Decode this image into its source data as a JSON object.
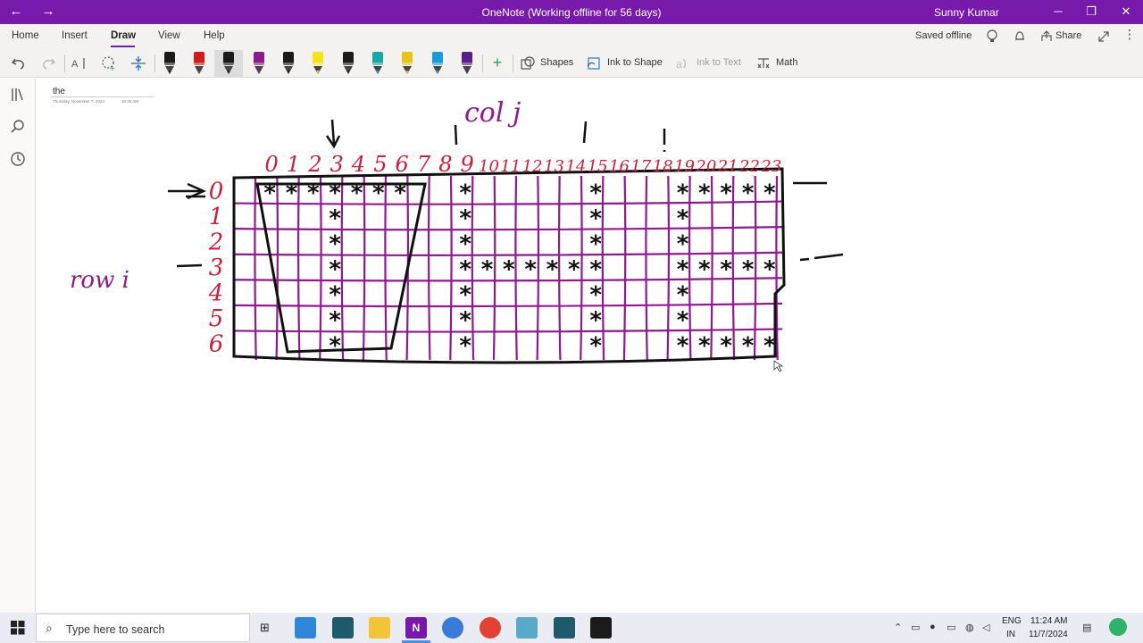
{
  "titlebar": {
    "title": "OneNote (Working offline for 56 days)",
    "user": "Sunny Kumar",
    "back": "←",
    "forward": "→",
    "minimize": "─",
    "maximize": "❐",
    "close": "✕"
  },
  "tabs": [
    "Home",
    "Insert",
    "Draw",
    "View",
    "Help"
  ],
  "active_tab": "Draw",
  "status": {
    "saved": "Saved offline",
    "share": "Share"
  },
  "toolbar": {
    "shapes": "Shapes",
    "ink_to_shape": "Ink to Shape",
    "ink_to_text": "Ink to Text",
    "math": "Math"
  },
  "pens": [
    {
      "color": "#1a1a1a"
    },
    {
      "color": "#d11c1c"
    },
    {
      "color": "#1a1a1a"
    },
    {
      "color": "#8b1d8b"
    },
    {
      "color": "#1a1a1a"
    },
    {
      "color": "#f4e21c"
    },
    {
      "color": "#1a1a1a"
    },
    {
      "color": "#1aa7a7"
    },
    {
      "color": "#e6c21c"
    },
    {
      "color": "#1a9ad6"
    },
    {
      "color": "#5a1d8b"
    }
  ],
  "page": {
    "title": "the",
    "date": "Thursday, November 7, 2024",
    "time": "10:25 AM"
  },
  "ink_labels": {
    "col": "col j",
    "row": "row i",
    "col_numbers": [
      "0",
      "1",
      "2",
      "3",
      "4",
      "5",
      "6",
      "7",
      "8",
      "9",
      "10",
      "11",
      "12",
      "13",
      "14",
      "15",
      "16",
      "17",
      "18",
      "19",
      "20",
      "21",
      "22",
      "23"
    ],
    "row_numbers": [
      "0",
      "1",
      "2",
      "3",
      "4",
      "5",
      "6"
    ],
    "star": "*"
  },
  "taskbar": {
    "search_placeholder": "Type here to search",
    "lang_top": "ENG",
    "lang_bottom": "IN",
    "time": "11:24 AM",
    "date": "11/7/2024"
  },
  "colors": {
    "brand": "#7719aa",
    "ink_black": "#111111",
    "ink_red": "#cc1f3a",
    "ink_purple": "#8e1a8e"
  }
}
